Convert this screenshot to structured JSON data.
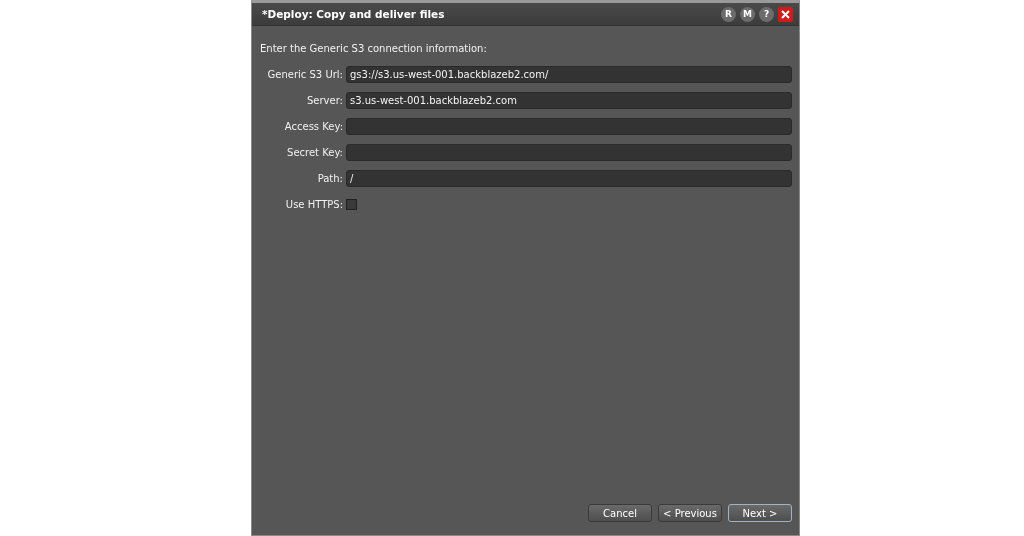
{
  "window": {
    "title": "*Deploy: Copy and deliver files",
    "title_buttons": [
      {
        "kind": "letter",
        "label": "R"
      },
      {
        "kind": "letter",
        "label": "M"
      },
      {
        "kind": "letter",
        "label": "?"
      },
      {
        "kind": "close"
      }
    ]
  },
  "intro": "Enter the Generic S3 connection information:",
  "fields": [
    {
      "kind": "text",
      "label": "Generic S3 Url:",
      "value": "gs3://s3.us-west-001.backblazeb2.com/"
    },
    {
      "kind": "text",
      "label": "Server:",
      "value": "s3.us-west-001.backblazeb2.com"
    },
    {
      "kind": "text",
      "label": "Access Key:"
    },
    {
      "kind": "text",
      "label": "Secret Key:"
    },
    {
      "kind": "text",
      "label": "Path:",
      "value": "/"
    },
    {
      "kind": "checkbox",
      "label": "Use HTTPS:",
      "checked": false
    }
  ],
  "buttons": [
    {
      "label": "Cancel",
      "default": false
    },
    {
      "label": "< Previous",
      "default": false
    },
    {
      "label": "Next >",
      "default": true
    }
  ]
}
